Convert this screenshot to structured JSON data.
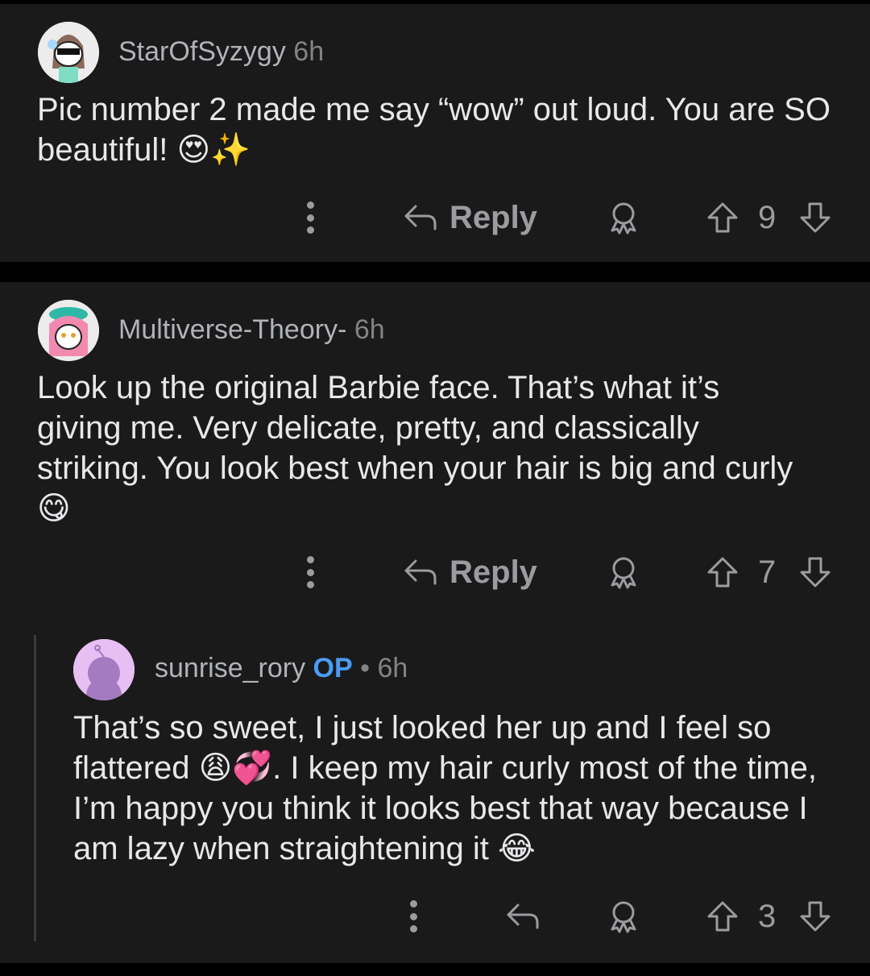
{
  "comments": [
    {
      "username": "StarOfSyzygy",
      "time": "6h",
      "body": "Pic number 2 made me say “wow” out loud. You are SO beautiful!",
      "body_emoji": "😍✨",
      "reply_label": "Reply",
      "score": "9"
    },
    {
      "username": "Multiverse-Theory-",
      "time": "6h",
      "body": "Look up the original Barbie face. That’s what it’s giving me. Very delicate, pretty, and classically striking. You look best when your hair is big and curly",
      "body_emoji": "😋",
      "reply_label": "Reply",
      "score": "7"
    },
    {
      "username": "sunrise_rory",
      "op_badge": "OP",
      "separator": "•",
      "time": "6h",
      "body_part1": "That’s so sweet, I just looked her up and I feel so flattered",
      "body_emoji1": "😩💞",
      "body_part2": ". I keep my hair curly most of the time, I’m happy you think it looks best that way because I am lazy when straightening it",
      "body_emoji2": "😂",
      "score": "3"
    }
  ],
  "icons": {
    "more": "more-options-icon",
    "reply": "reply-arrow-icon",
    "award": "award-icon",
    "upvote": "upvote-icon",
    "downvote": "downvote-icon"
  },
  "colors": {
    "background": "#000000",
    "card": "#1a1a1b",
    "text": "#e6e8ea",
    "meta": "#818384",
    "op": "#4a9cf5"
  }
}
